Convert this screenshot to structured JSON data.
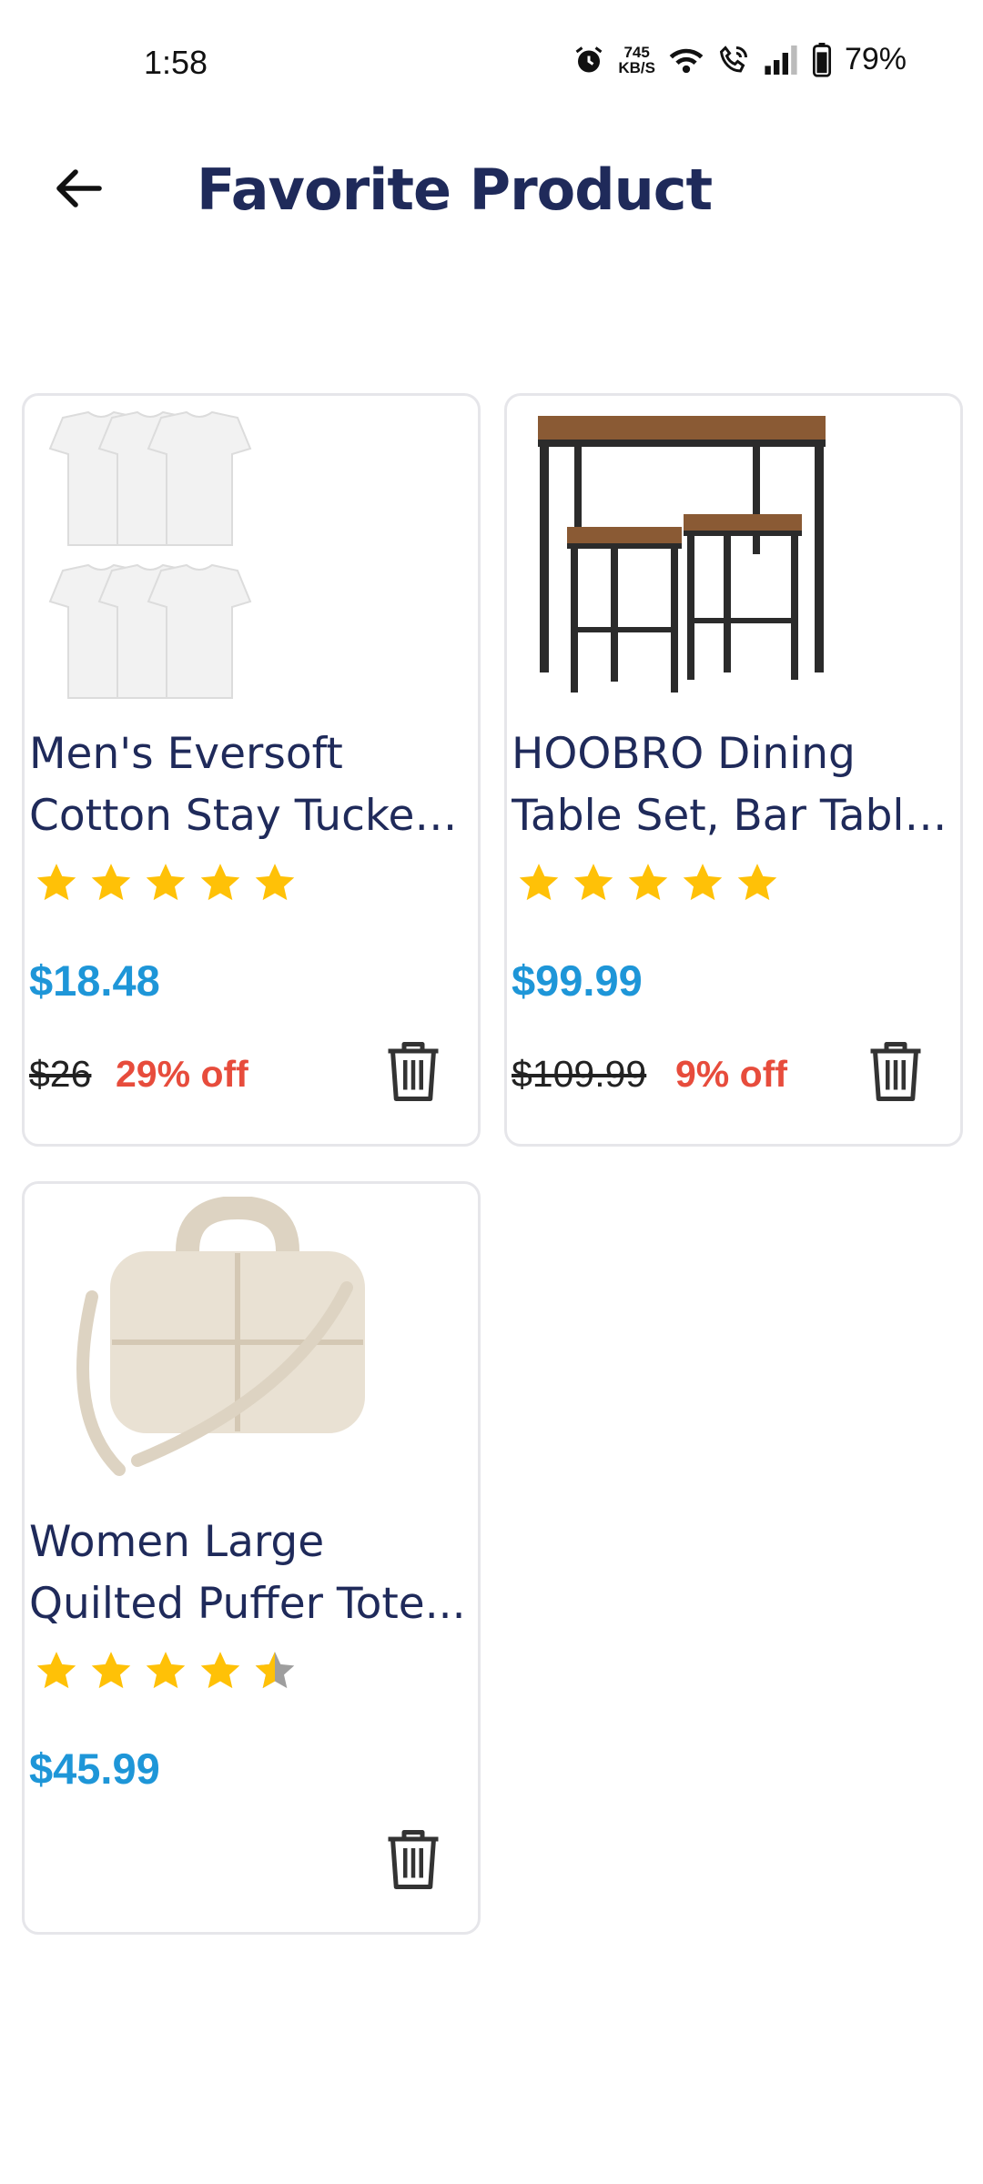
{
  "status_bar": {
    "time": "1:58",
    "net_speed_value": "745",
    "net_speed_unit": "KB/S",
    "battery": "79%"
  },
  "header": {
    "title": "Favorite Product",
    "back_icon": "back-arrow-icon"
  },
  "products": [
    {
      "title_line1": "Men's Eversoft",
      "title_line2": "Cotton Stay Tucked...",
      "rating": 5,
      "price": "$18.48",
      "original_price": "$26",
      "discount": "29% off",
      "image": "white-tshirts-pack"
    },
    {
      "title_line1": "HOOBRO Dining",
      "title_line2": "Table Set, Bar Table...",
      "rating": 5,
      "price": "$99.99",
      "original_price": "$109.99",
      "discount": "9% off",
      "image": "bar-table-with-stools"
    },
    {
      "title_line1": "Women Large",
      "title_line2": "Quilted Puffer Tote...",
      "rating": 4.5,
      "price": "$45.99",
      "image": "beige-quilted-tote-bag"
    }
  ],
  "colors": {
    "title": "#1f2a5a",
    "price": "#1e96d8",
    "discount": "#e74c3c",
    "star": "#FFC107",
    "star_empty": "#9e9e9e"
  }
}
